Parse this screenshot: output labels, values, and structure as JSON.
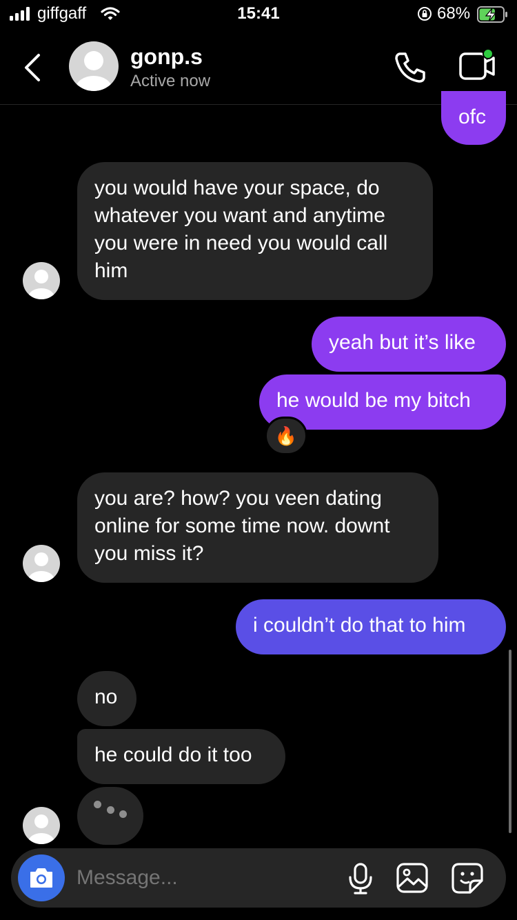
{
  "status_bar": {
    "carrier": "giffgaff",
    "time": "15:41",
    "battery_percent": "68%",
    "battery_level": 0.68,
    "signal_bars": 4
  },
  "header": {
    "username": "gonp.s",
    "status": "Active now",
    "icons": [
      "back-chevron-icon",
      "phone-icon",
      "video-camera-icon"
    ]
  },
  "messages": [
    {
      "from": "me",
      "text": "ofc"
    },
    {
      "from": "them",
      "text": "you would have your space, do\nwhatever you want and anytime\nyou were in need you would call\nhim"
    },
    {
      "from": "me",
      "text": "yeah but it’s like"
    },
    {
      "from": "me",
      "text": "he would be my bitch",
      "reaction": "🔥"
    },
    {
      "from": "them",
      "text": "you are? how? you veen dating\nonline for some time now. downt\nyou miss it?"
    },
    {
      "from": "me",
      "text": "i couldn’t do that to him"
    },
    {
      "from": "them",
      "text": "no"
    },
    {
      "from": "them",
      "text": "he could do it too"
    }
  ],
  "typing_indicator": true,
  "composer": {
    "placeholder": "Message...",
    "icons": [
      "camera-icon",
      "microphone-icon",
      "gallery-icon",
      "sticker-icon"
    ]
  },
  "colors": {
    "background": "#000000",
    "incoming_bubble": "#262626",
    "outgoing_bubble_top": "#8c3cf0",
    "outgoing_bubble_bottom": "#5a4fe6",
    "camera_button": "#3a6fe8",
    "active_dot": "#2ecc40",
    "battery_charging": "#5fd35a"
  }
}
